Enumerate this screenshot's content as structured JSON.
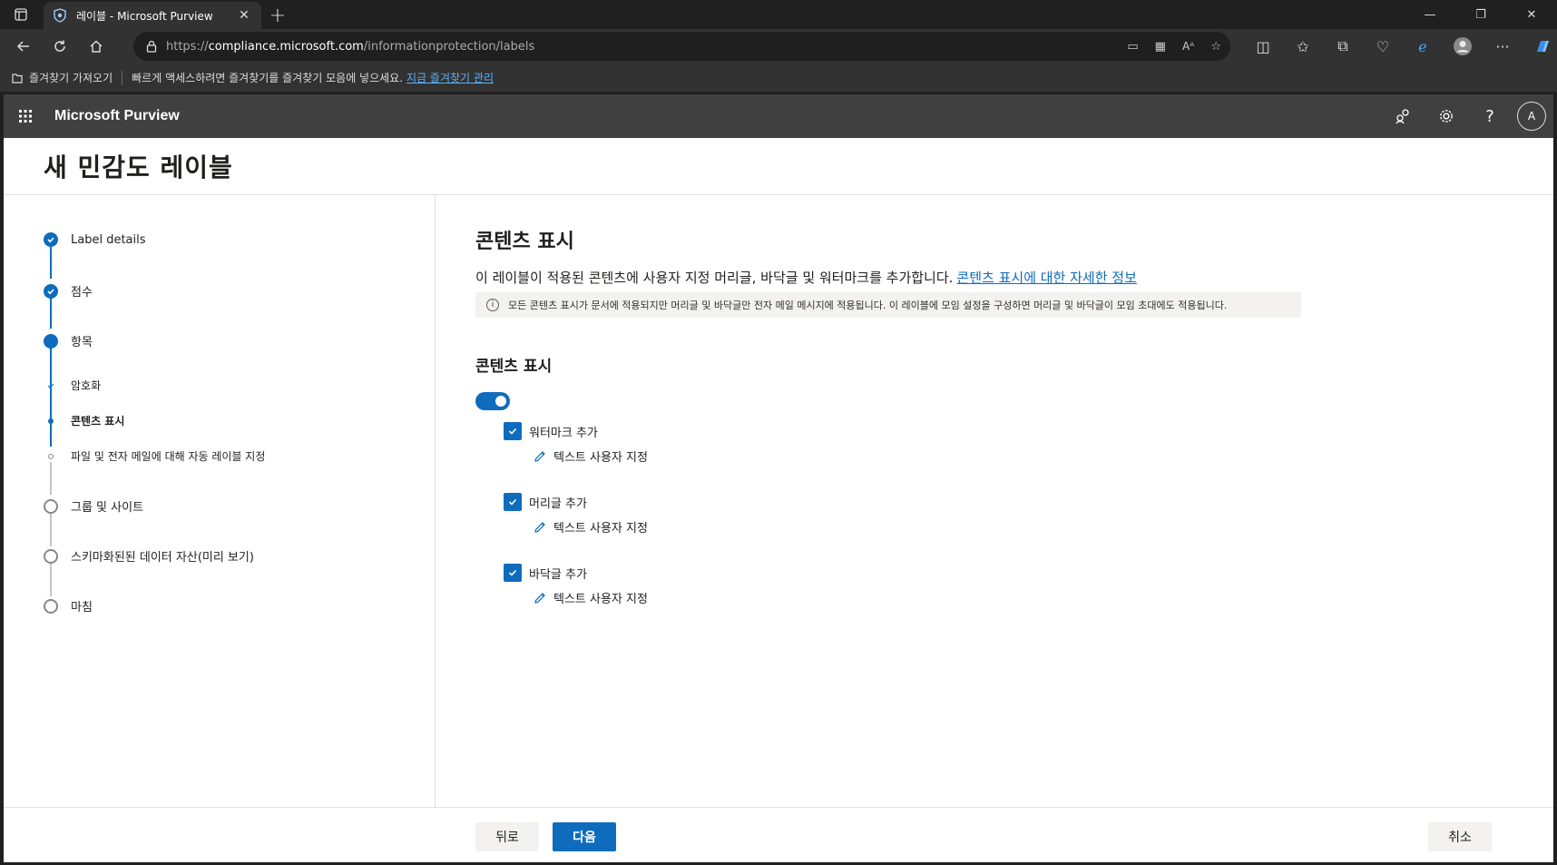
{
  "browser": {
    "tab_title": "레이블 - Microsoft Purview",
    "url_prefix": "https://",
    "url_host": "compliance.microsoft.com",
    "url_path": "/informationprotection/labels",
    "favorites_import": "즐겨찾기 가져오기",
    "favorites_message": "빠르게 액세스하려면 즐겨찾기를 즐겨찾기 모음에 넣으세요.",
    "favorites_manage_link": "지금 즐겨찾기 관리"
  },
  "suite": {
    "brand": "Microsoft Purview",
    "avatar_initial": "A"
  },
  "page": {
    "title": "새 민감도 레이블"
  },
  "stepper": {
    "steps": [
      {
        "label": "Label details",
        "state": "done"
      },
      {
        "label": "점수",
        "state": "done"
      },
      {
        "label": "항목",
        "state": "current"
      },
      {
        "label": "암호화",
        "state": "sub-done"
      },
      {
        "label": "콘텐츠 표시",
        "state": "sub-current"
      },
      {
        "label": "파일 및 전자 메일에 대해 자동 레이블 지정",
        "state": "sub-pending"
      },
      {
        "label": "그룹 및 사이트",
        "state": "pending"
      },
      {
        "label": "스키마화된된 데이터 자산(미리 보기)",
        "state": "pending"
      },
      {
        "label": "마침",
        "state": "pending"
      }
    ]
  },
  "content": {
    "title": "콘텐츠 표시",
    "description": "이 레이블이 적용된 콘텐츠에 사용자 지정 머리글, 바닥글 및 워터마크를 추가합니다.",
    "learn_more_link": "콘텐츠 표시에 대한 자세한 정보",
    "info_text": "모든 콘텐츠 표시가 문서에 적용되지만 머리글 및 바닥글만 전자 메일 메시지에 적용됩니다. 이 레이블에 모임 설정을 구성하면 머리글 및 바닥글이 모임 초대에도 적용됩니다.",
    "subtitle": "콘텐츠 표시",
    "toggle_on": true,
    "options": [
      {
        "label": "워터마크 추가",
        "checked": true,
        "edit_label": "텍스트 사용자 지정"
      },
      {
        "label": "머리글 추가",
        "checked": true,
        "edit_label": "텍스트 사용자 지정"
      },
      {
        "label": "바닥글 추가",
        "checked": true,
        "edit_label": "텍스트 사용자 지정"
      }
    ]
  },
  "footer": {
    "back_label": "뒤로",
    "next_label": "다음",
    "cancel_label": "취소"
  },
  "colors": {
    "accent": "#0f6cbd",
    "suitebar": "#404040"
  }
}
